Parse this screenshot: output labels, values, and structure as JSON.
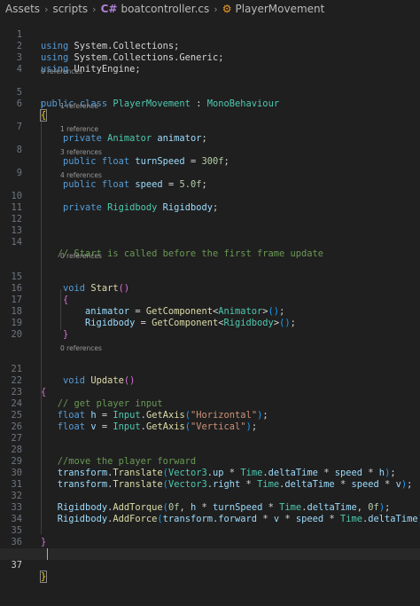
{
  "breadcrumb": {
    "items": [
      "Assets",
      "scripts",
      "boatcontroller.cs",
      "PlayerMovement"
    ],
    "file_icon": "C#"
  },
  "lens": {
    "l5": "0 references",
    "l7": "1 reference",
    "l8": "1 reference",
    "l9": "3 references",
    "l10": "4 references",
    "l15": "0 references",
    "l21": "0 references"
  },
  "code": {
    "l1_kw": "using",
    "l1_ns": "System.Collections",
    "l2_kw": "using",
    "l2_ns": "System.Collections.Generic",
    "l3_kw": "using",
    "l3_ns": "UnityEngine",
    "l5_kw1": "public",
    "l5_kw2": "class",
    "l5_name": "PlayerMovement",
    "l5_sep": ":",
    "l5_base": "MonoBehaviour",
    "l7_kw": "private",
    "l7_type": "Animator",
    "l7_var": "animator",
    "l8_kw1": "public",
    "l8_kw2": "float",
    "l8_var": "turnSpeed",
    "l8_val": "300f",
    "l9_kw1": "public",
    "l9_kw2": "float",
    "l9_var": "speed",
    "l9_val": "5.0f",
    "l10_kw": "private",
    "l10_type": "Rigidbody",
    "l10_var": "Rigidbody",
    "l14_comment": "// Start is called before the first frame update",
    "l15_kw": "void",
    "l15_fn": "Start",
    "l17_var": "animator",
    "l17_fn": "GetComponent",
    "l17_type": "Animator",
    "l18_var": "Rigidbody",
    "l18_fn": "GetComponent",
    "l18_type": "Rigidbody",
    "l21_kw": "void",
    "l21_fn": "Update",
    "l24_comment": "// get player input",
    "l25_kw": "float",
    "l25_var": "h",
    "l25_cls": "Input",
    "l25_fn": "GetAxis",
    "l25_str": "\"Horizontal\"",
    "l26_kw": "float",
    "l26_var": "v",
    "l26_cls": "Input",
    "l26_fn": "GetAxis",
    "l26_str": "\"Vertical\"",
    "l28_comment": "//move the player forward",
    "l29_obj": "transform",
    "l29_fn": "Translate",
    "l29_cls": "Vector3",
    "l29_prop": "up",
    "l29_time": "Time",
    "l29_dt": "deltaTime",
    "l29_speed": "speed",
    "l29_h": "h",
    "l30_obj": "transform",
    "l30_fn": "Translate",
    "l30_cls": "Vector3",
    "l30_prop": "right",
    "l30_time": "Time",
    "l30_dt": "deltaTime",
    "l30_speed": "speed",
    "l30_v": "v",
    "l32_obj": "Rigidbody",
    "l32_fn": "AddTorque",
    "l32_zero": "0f",
    "l32_h": "h",
    "l32_ts": "turnSpeed",
    "l32_time": "Time",
    "l32_dt": "deltaTime",
    "l32_zero2": "0f",
    "l33_obj": "Rigidbody",
    "l33_fn": "AddForce",
    "l33_tr": "transform",
    "l33_fw": "forward",
    "l33_v": "v",
    "l33_speed": "speed",
    "l33_time": "Time",
    "l33_dt": "deltaTime"
  },
  "line_numbers": [
    "1",
    "2",
    "3",
    "4",
    "5",
    "6",
    "7",
    "8",
    "9",
    "10",
    "11",
    "12",
    "13",
    "14",
    "15",
    "16",
    "17",
    "18",
    "19",
    "20",
    "21",
    "22",
    "23",
    "24",
    "25",
    "26",
    "27",
    "28",
    "29",
    "30",
    "31",
    "32",
    "33",
    "34",
    "35",
    "36",
    "37"
  ],
  "colors": {
    "background": "#1f1f1f",
    "keyword": "#569cd6",
    "type": "#4ec9b0",
    "function": "#dcdcaa",
    "string": "#ce9178",
    "number": "#b5cea8",
    "comment": "#6a9955",
    "identifier": "#9cdcfe"
  }
}
